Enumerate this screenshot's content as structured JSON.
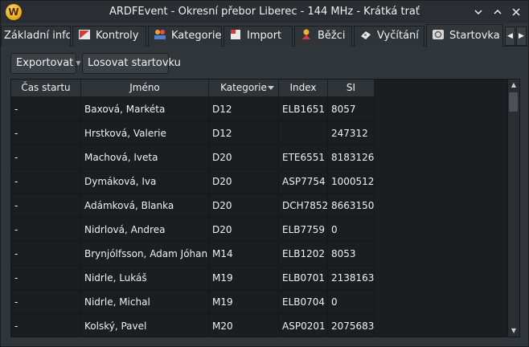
{
  "window": {
    "title": "ARDFEvent - Okresní přebor Liberec - 144 MHz - Krátká trať",
    "app_icon_letter": "W"
  },
  "tabs": [
    {
      "label": "Základní info",
      "icon": "none"
    },
    {
      "label": "Kontroly",
      "icon": "controls-icon"
    },
    {
      "label": "Kategorie",
      "icon": "categories-icon"
    },
    {
      "label": "Import",
      "icon": "import-icon"
    },
    {
      "label": "Běžci",
      "icon": "runners-icon"
    },
    {
      "label": "Vyčítání",
      "icon": "readout-icon"
    },
    {
      "label": "Startovka",
      "icon": "startlist-icon",
      "active": true
    }
  ],
  "toolbar": {
    "export_label": "Exportovat",
    "draw_label": "Losovat startovku"
  },
  "table": {
    "headers": {
      "start_time": "Čas startu",
      "name": "Jméno",
      "category": "Kategorie",
      "index": "Index",
      "si": "SI"
    },
    "rows": [
      {
        "start": "-",
        "name": "Baxová, Markéta",
        "category": "D12",
        "index": "ELB1651",
        "si": "8057"
      },
      {
        "start": "-",
        "name": "Hrstková, Valerie",
        "category": "D12",
        "index": "",
        "si": "247312"
      },
      {
        "start": "-",
        "name": "Machová, Iveta",
        "category": "D20",
        "index": "ETE6551",
        "si": "8183126"
      },
      {
        "start": "-",
        "name": "Dymáková, Iva",
        "category": "D20",
        "index": "ASP7754",
        "si": "1000512"
      },
      {
        "start": "-",
        "name": "Adámková, Blanka",
        "category": "D20",
        "index": "DCH7852",
        "si": "8663150"
      },
      {
        "start": "-",
        "name": "Nidrlová, Andrea",
        "category": "D20",
        "index": "ELB7759",
        "si": "0"
      },
      {
        "start": "-",
        "name": "Brynjólfsson, Adam Jóhannsson",
        "category": "M14",
        "index": "ELB1202",
        "si": "8053"
      },
      {
        "start": "-",
        "name": "Nidrle, Lukáš",
        "category": "M19",
        "index": "ELB0701",
        "si": "2138163"
      },
      {
        "start": "-",
        "name": "Nidrle, Michal",
        "category": "M19",
        "index": "ELB0704",
        "si": "0"
      },
      {
        "start": "-",
        "name": "Kolský, Pavel",
        "category": "M20",
        "index": "ASP0201",
        "si": "2075683"
      }
    ]
  },
  "colors": {
    "window_bg": "#31363b",
    "table_bg": "#1b1e20",
    "text": "#eff0f1",
    "app_icon": "#f0b429"
  }
}
